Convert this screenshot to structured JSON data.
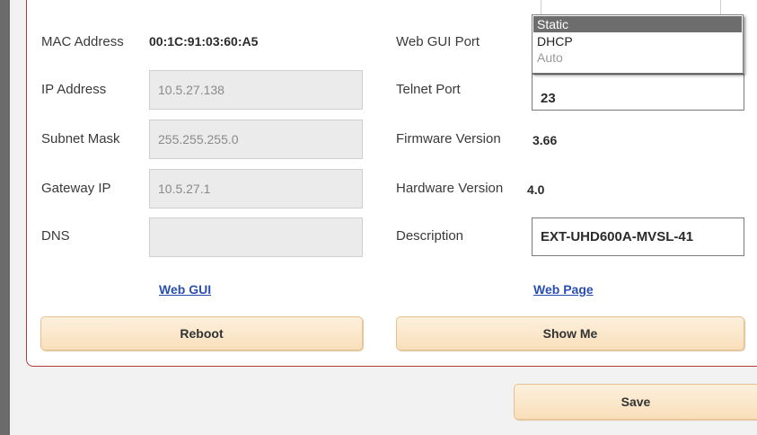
{
  "network": {
    "mac_label": "MAC Address",
    "mac_value": "00:1C:91:03:60:A5",
    "ip_label": "IP Address",
    "ip_value": "10.5.27.138",
    "subnet_label": "Subnet Mask",
    "subnet_value": "255.255.255.0",
    "gateway_label": "Gateway IP",
    "gateway_value": "10.5.27.1",
    "dns_label": "DNS",
    "dns_value": ""
  },
  "device": {
    "webgui_port_label": "Web GUI Port",
    "telnet_port_label": "Telnet Port",
    "telnet_port_value": "23",
    "firmware_label": "Firmware Version",
    "firmware_value": "3.66",
    "hardware_label": "Hardware Version",
    "hardware_value": "4.0",
    "description_label": "Description",
    "description_value": "EXT-UHD600A-MVSL-41"
  },
  "dropdown": {
    "options": [
      "Static",
      "DHCP",
      "Auto"
    ],
    "selected": "Static",
    "disabled": "Auto"
  },
  "links": {
    "web_gui": "Web GUI",
    "web_page": "Web Page"
  },
  "buttons": {
    "reboot": "Reboot",
    "show_me": "Show Me",
    "save": "Save"
  },
  "colors": {
    "panel_border": "#b43a3a",
    "button_fill": "#fce6c8",
    "link": "#2a4fb0",
    "dropdown_selected": "#6d6d6d"
  }
}
